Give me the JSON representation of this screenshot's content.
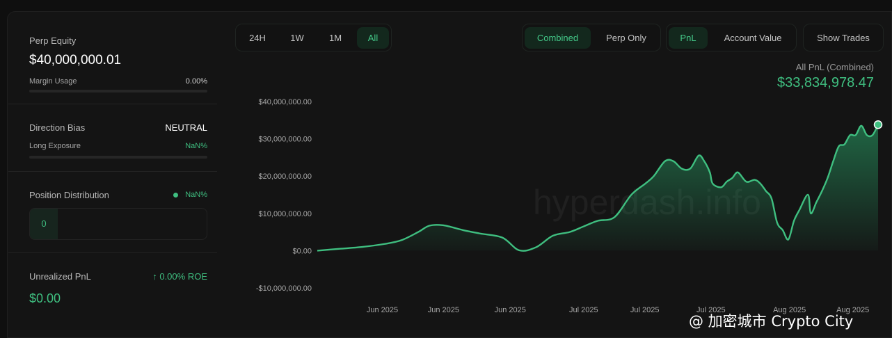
{
  "colors": {
    "accent": "#3fbf80",
    "bg": "#141414",
    "active_bg": "#13281d"
  },
  "left": {
    "perp_equity": {
      "label": "Perp Equity",
      "value": "$40,000,000.01",
      "margin_label": "Margin Usage",
      "margin_value": "0.00%",
      "margin_fraction": 0
    },
    "direction": {
      "label": "Direction Bias",
      "value": "NEUTRAL",
      "exposure_label": "Long Exposure",
      "exposure_value": "NaN%"
    },
    "distribution": {
      "label": "Position Distribution",
      "value": "NaN%",
      "count": "0"
    },
    "unrealized": {
      "label": "Unrealized PnL",
      "roe": "0.00% ROE",
      "roe_icon": "arrow-up-icon",
      "value": "$0.00"
    }
  },
  "toolbar": {
    "ranges": [
      {
        "label": "24H",
        "active": false
      },
      {
        "label": "1W",
        "active": false
      },
      {
        "label": "1M",
        "active": false
      },
      {
        "label": "All",
        "active": true
      }
    ],
    "modes": [
      {
        "label": "Combined",
        "active": true
      },
      {
        "label": "Perp Only",
        "active": false
      }
    ],
    "metrics": [
      {
        "label": "PnL",
        "active": true
      },
      {
        "label": "Account Value",
        "active": false
      }
    ],
    "show_trades": "Show Trades"
  },
  "headline": {
    "label": "All PnL (Combined)",
    "value": "$33,834,978.47"
  },
  "watermark": "hyperdash.info",
  "corner_watermark": "@ 加密城市 Crypto City",
  "chart_data": {
    "type": "area",
    "ylim": [
      -10000000,
      40000000
    ],
    "y_ticks": [
      {
        "value": 40000000,
        "label": "$40,000,000.00"
      },
      {
        "value": 30000000,
        "label": "$30,000,000.00"
      },
      {
        "value": 20000000,
        "label": "$20,000,000.00"
      },
      {
        "value": 10000000,
        "label": "$10,000,000.00"
      },
      {
        "value": 0,
        "label": "$0.00"
      },
      {
        "value": -10000000,
        "label": "-$10,000,000.00"
      }
    ],
    "x_ticks": [
      {
        "t": 0.116,
        "label": "Jun 2025"
      },
      {
        "t": 0.225,
        "label": "Jun 2025"
      },
      {
        "t": 0.344,
        "label": "Jun 2025"
      },
      {
        "t": 0.475,
        "label": "Jul 2025"
      },
      {
        "t": 0.584,
        "label": "Jul 2025"
      },
      {
        "t": 0.702,
        "label": "Jul 2025"
      },
      {
        "t": 0.842,
        "label": "Aug 2025"
      },
      {
        "t": 0.955,
        "label": "Aug 2025"
      }
    ],
    "series": [
      {
        "x": [
          0,
          0.04,
          0.08,
          0.12,
          0.15,
          0.18,
          0.2,
          0.225,
          0.26,
          0.29,
          0.33,
          0.36,
          0.39,
          0.42,
          0.45,
          0.475,
          0.5,
          0.53,
          0.56,
          0.585,
          0.6,
          0.62,
          0.635,
          0.65,
          0.665,
          0.68,
          0.69,
          0.7,
          0.705,
          0.72,
          0.73,
          0.74,
          0.75,
          0.765,
          0.78,
          0.79,
          0.8,
          0.81,
          0.82,
          0.83,
          0.84,
          0.85,
          0.86,
          0.875,
          0.88,
          0.89,
          0.9,
          0.91,
          0.92,
          0.93,
          0.94,
          0.95,
          0.96,
          0.97,
          0.98,
          0.99,
          1.0
        ],
        "values": [
          0,
          500000,
          1000000,
          1800000,
          2800000,
          5000000,
          6700000,
          6800000,
          5500000,
          4600000,
          3500000,
          100000,
          900000,
          4000000,
          5000000,
          6500000,
          8000000,
          9000000,
          15000000,
          18000000,
          20000000,
          24000000,
          24000000,
          22000000,
          22000000,
          25500000,
          24000000,
          21000000,
          18000000,
          17000000,
          18500000,
          19500000,
          21000000,
          18500000,
          19000000,
          18000000,
          16000000,
          14000000,
          7500000,
          5500000,
          3000000,
          8000000,
          11000000,
          15000000,
          10000000,
          13000000,
          16000000,
          19500000,
          24000000,
          28000000,
          28500000,
          31000000,
          31000000,
          33500000,
          31000000,
          31000000,
          33800000
        ]
      }
    ]
  }
}
